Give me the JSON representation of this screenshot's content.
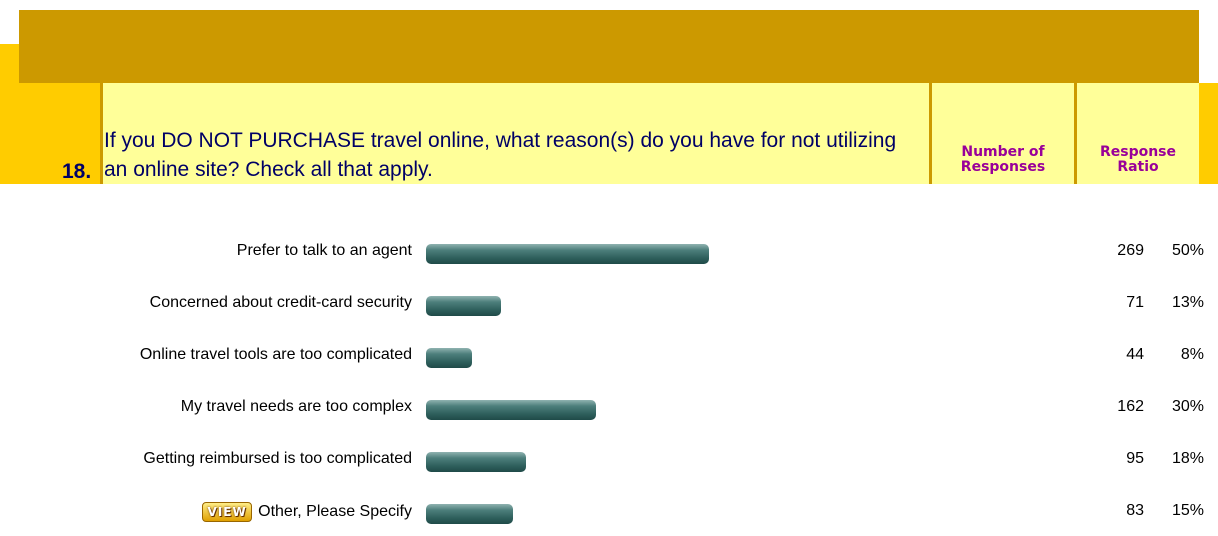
{
  "question": {
    "number": "18.",
    "text": "If you DO NOT PURCHASE travel online, what reason(s) do you have for not utilizing an online site? Check all that apply."
  },
  "columns": {
    "responses_header": "Number of Responses",
    "ratio_header": "Response Ratio"
  },
  "view_button_label": "VIEW",
  "colors": {
    "header_gold": "#cc9900",
    "header_yellow": "#ffcc00",
    "header_pale": "#ffff99",
    "question_text": "#000066",
    "column_header": "#990099",
    "bar": "#2e5f5c"
  },
  "chart_data": {
    "type": "bar",
    "orientation": "horizontal",
    "categories": [
      "Prefer to talk to an agent",
      "Concerned about credit-card security",
      "Online travel tools are too complicated",
      "My travel needs are too complex",
      "Getting reimbursed is too complicated",
      "Other, Please Specify"
    ],
    "values": [
      269,
      71,
      44,
      162,
      95,
      83
    ],
    "ratios": [
      "50%",
      "13%",
      "8%",
      "30%",
      "18%",
      "15%"
    ]
  }
}
